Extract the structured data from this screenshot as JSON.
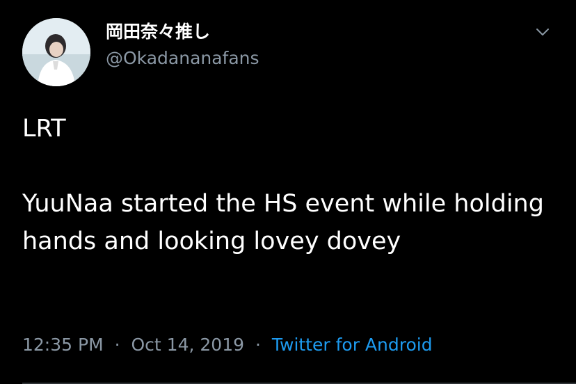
{
  "tweet": {
    "author": {
      "display_name": "岡田奈々推し",
      "handle": "@Okadananafans"
    },
    "text": "LRT\n\nYuuNaa started the HS event while holding hands and looking lovey dovey",
    "time": "12:35 PM",
    "date": "Oct 14, 2019",
    "separator": "·",
    "source": "Twitter for Android"
  },
  "icons": {
    "menu": "chevron-down-icon",
    "avatar": "profile-photo"
  },
  "colors": {
    "background": "#000000",
    "primary_text": "#ffffff",
    "secondary_text": "#8b98a5",
    "link": "#1d9bf0",
    "divider": "#2f3336"
  }
}
